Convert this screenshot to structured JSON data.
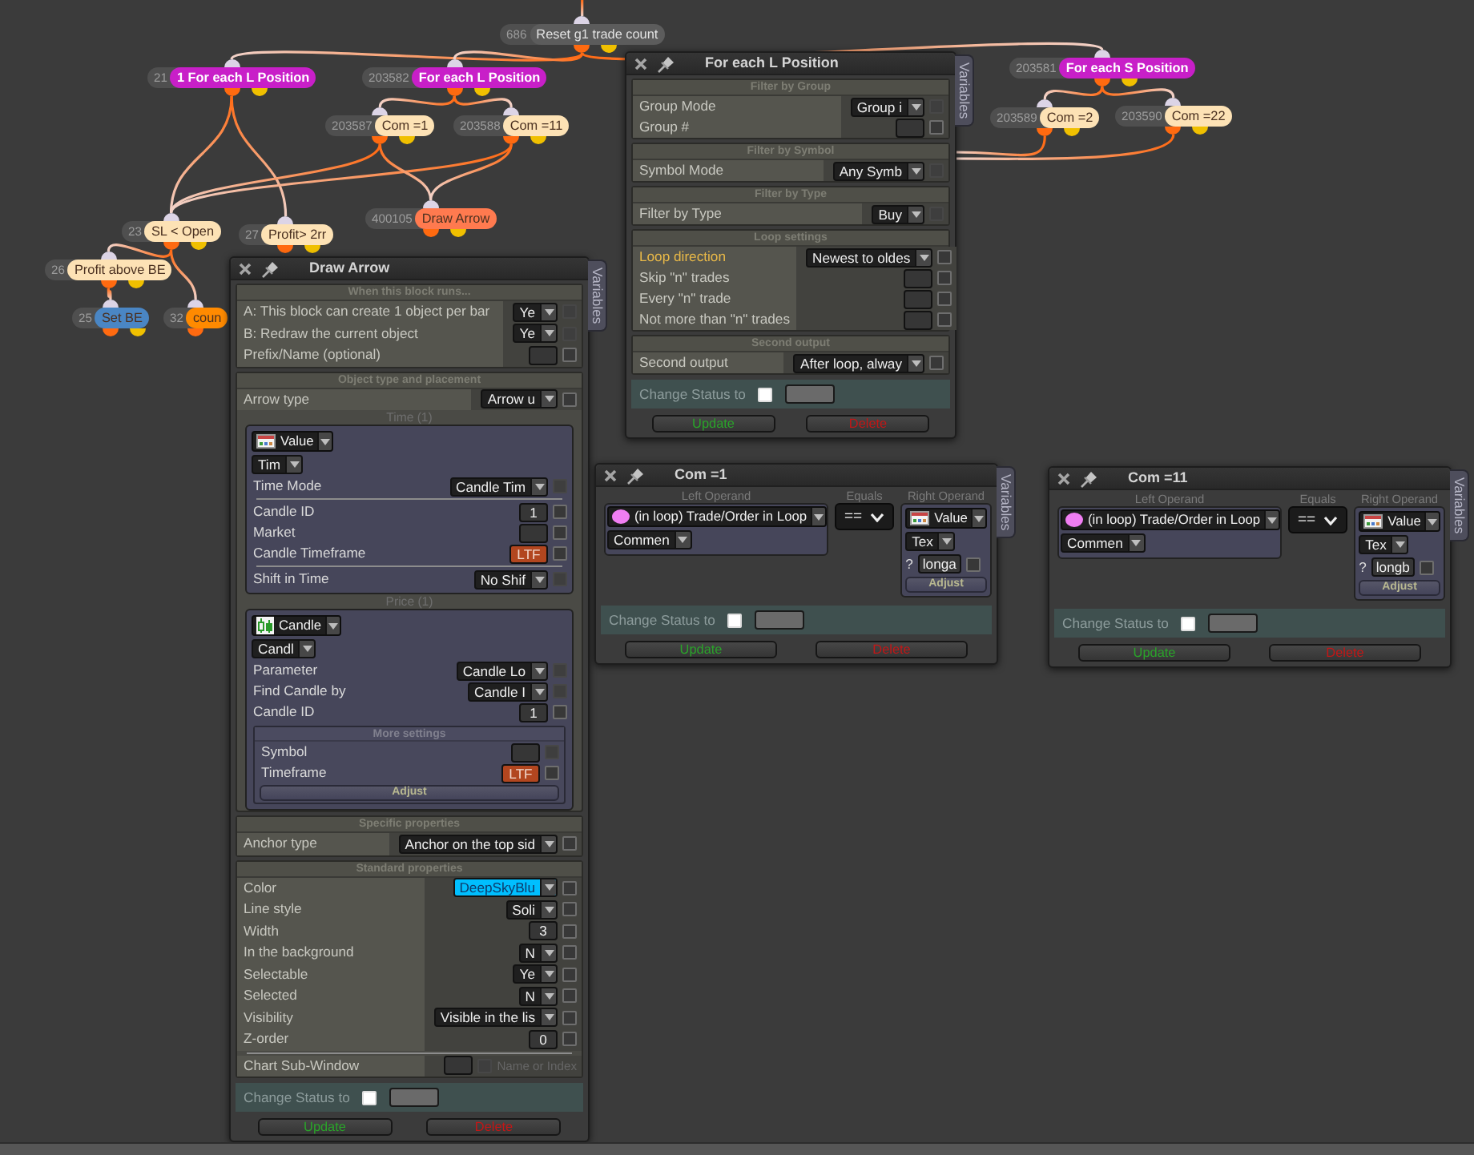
{
  "nodes": [
    {
      "number": "686",
      "label": "Reset g1 trade count",
      "color": "#5c5c5c"
    },
    {
      "number": "21",
      "label": "1 For each L Position",
      "color": "#c81fc8"
    },
    {
      "number": "203582",
      "label": "For each L Position",
      "color": "#c81fc8"
    },
    {
      "number": "203587",
      "label": "Com =1",
      "color": "#fde2b5"
    },
    {
      "number": "203588",
      "label": "Com =11",
      "color": "#fde2b5"
    },
    {
      "number": "400105",
      "label": "Draw Arrow",
      "color": "#ff7a4f"
    },
    {
      "number": "23",
      "label": "SL < Open",
      "color": "#fde2b5"
    },
    {
      "number": "27",
      "label": "Profit> 2rr",
      "color": "#fde2b5"
    },
    {
      "number": "26",
      "label": "Profit above BE",
      "color": "#fde2b5"
    },
    {
      "number": "25",
      "label": "Set BE",
      "color": "#4a86c4"
    },
    {
      "number": "32",
      "label": "coun",
      "color": "#ff8a00"
    },
    {
      "number": "203581",
      "label": "For each S Position",
      "color": "#c81fc8"
    },
    {
      "number": "203589",
      "label": "Com =2",
      "color": "#fde2b5"
    },
    {
      "number": "203590",
      "label": "Com =22",
      "color": "#fde2b5"
    }
  ],
  "panels": [
    {
      "kind": "block",
      "title": "For each L Position",
      "side_tab": "Variables",
      "sections": [
        {
          "title": "Filter by Group",
          "items": [
            {
              "kind": "row",
              "label": "Group Mode",
              "control": {
                "kind": "dropdown",
                "value": "Group i"
              },
              "checkbox": {
                "checked": false,
                "disabled": true
              }
            },
            {
              "kind": "row",
              "label": "Group #",
              "control": {
                "kind": "field"
              },
              "checkbox": {
                "checked": false,
                "disabled": false
              }
            }
          ]
        },
        {
          "title": "Filter by Symbol",
          "items": [
            {
              "kind": "row",
              "label": "Symbol Mode",
              "control": {
                "kind": "dropdown",
                "value": "Any Symb"
              },
              "checkbox": {
                "checked": false,
                "disabled": true
              }
            }
          ]
        },
        {
          "title": "Filter by Type",
          "items": [
            {
              "kind": "row",
              "label": "Filter by Type",
              "control": {
                "kind": "dropdown",
                "value": "Buy"
              },
              "checkbox": {
                "checked": false,
                "disabled": true
              }
            }
          ]
        },
        {
          "title": "Loop settings",
          "items": [
            {
              "kind": "row",
              "label": "Loop direction",
              "highlighted": true,
              "control": {
                "kind": "dropdown",
                "value": "Newest to oldes"
              },
              "checkbox": {
                "checked": false,
                "disabled": false
              }
            },
            {
              "kind": "row",
              "label": "Skip \"n\" trades",
              "highlighted": false,
              "control": {
                "kind": "field"
              },
              "checkbox": {
                "checked": false,
                "disabled": false
              }
            },
            {
              "kind": "row",
              "label": "Every \"n\" trade",
              "highlighted": false,
              "control": {
                "kind": "field"
              },
              "checkbox": {
                "checked": false,
                "disabled": false
              }
            },
            {
              "kind": "row",
              "label": "Not more than \"n\" trades",
              "highlighted": false,
              "control": {
                "kind": "field"
              },
              "checkbox": {
                "checked": false,
                "disabled": false
              }
            }
          ]
        },
        {
          "title": "Second output",
          "items": [
            {
              "kind": "row",
              "label": "Second output",
              "control": {
                "kind": "dropdown",
                "value": "After loop, alway"
              },
              "checkbox": {
                "checked": false,
                "disabled": false
              }
            }
          ]
        }
      ],
      "change_status": {
        "label": "Change Status to",
        "checked": false
      },
      "buttons": [
        {
          "label": "Update",
          "kind": "update"
        },
        {
          "label": "Delete",
          "kind": "delete"
        }
      ]
    },
    {
      "kind": "block",
      "title": "Draw Arrow",
      "side_tab": "Variables",
      "sections": [
        {
          "title": "When this block runs...",
          "items": [
            {
              "kind": "row",
              "label": "A: This block can create 1 object per bar",
              "control": {
                "kind": "dropdown",
                "value": "Ye"
              },
              "checkbox": {
                "checked": false,
                "disabled": true
              }
            },
            {
              "kind": "row",
              "label": "B: Redraw the current object",
              "control": {
                "kind": "dropdown",
                "value": "Ye"
              },
              "checkbox": {
                "checked": false,
                "disabled": true
              }
            },
            {
              "kind": "row",
              "label": "Prefix/Name (optional)",
              "control": {
                "kind": "field"
              },
              "checkbox": {
                "checked": false,
                "disabled": false
              }
            }
          ]
        },
        {
          "title": "Object type and placement",
          "items": [
            {
              "kind": "row",
              "label": "Arrow type",
              "control": {
                "kind": "dropdown",
                "value": "Arrow u"
              },
              "checkbox": {
                "checked": false,
                "disabled": false
              }
            },
            {
              "kind": "caption",
              "text": "Time (1)"
            },
            {
              "kind": "box",
              "items": [
                {
                  "kind": "value_picker",
                  "label": "Value"
                },
                {
                  "kind": "select",
                  "value": "Tim"
                },
                {
                  "kind": "row",
                  "label": "Time Mode",
                  "control": {
                    "kind": "dropdown",
                    "value": "Candle Tim"
                  },
                  "checkbox": {
                    "checked": false,
                    "disabled": true
                  }
                },
                {
                  "kind": "divider"
                },
                {
                  "kind": "row",
                  "label": "Candle ID",
                  "control": {
                    "kind": "field",
                    "value": "1"
                  },
                  "checkbox": {
                    "checked": false,
                    "disabled": false
                  }
                },
                {
                  "kind": "row",
                  "label": "Market",
                  "control": {
                    "kind": "field"
                  },
                  "checkbox": {
                    "checked": false,
                    "disabled": false
                  }
                },
                {
                  "kind": "row",
                  "label": "Candle Timeframe",
                  "control": {
                    "kind": "tag",
                    "value": "LTF"
                  },
                  "checkbox": {
                    "checked": false,
                    "disabled": false
                  }
                },
                {
                  "kind": "divider"
                },
                {
                  "kind": "row",
                  "label": "Shift in Time",
                  "control": {
                    "kind": "dropdown",
                    "value": "No Shif"
                  },
                  "checkbox": {
                    "checked": false,
                    "disabled": true
                  }
                }
              ]
            },
            {
              "kind": "caption",
              "text": "Price (1)"
            },
            {
              "kind": "box",
              "items": [
                {
                  "kind": "candle_picker",
                  "label": "Candle"
                },
                {
                  "kind": "select",
                  "value": "Candl"
                },
                {
                  "kind": "row",
                  "label": "Parameter",
                  "control": {
                    "kind": "dropdown",
                    "value": "Candle Lo"
                  },
                  "checkbox": {
                    "checked": false,
                    "disabled": true
                  }
                },
                {
                  "kind": "row",
                  "label": "Find Candle by",
                  "control": {
                    "kind": "dropdown",
                    "value": "Candle I"
                  },
                  "checkbox": {
                    "checked": false,
                    "disabled": true
                  }
                },
                {
                  "kind": "row",
                  "label": "Candle ID",
                  "control": {
                    "kind": "field",
                    "value": "1"
                  },
                  "checkbox": {
                    "checked": false,
                    "disabled": false
                  }
                },
                {
                  "kind": "section",
                  "title": "More settings",
                  "items": [
                    {
                      "kind": "row",
                      "label": "Symbol",
                      "control": {
                        "kind": "field"
                      },
                      "checkbox": {
                        "checked": false,
                        "disabled": true
                      }
                    },
                    {
                      "kind": "row",
                      "label": "Timeframe",
                      "control": {
                        "kind": "tag",
                        "value": "LTF"
                      },
                      "checkbox": {
                        "checked": false,
                        "disabled": false
                      }
                    },
                    {
                      "kind": "adjust",
                      "label": "Adjust"
                    }
                  ]
                }
              ]
            }
          ]
        },
        {
          "title": "Specific properties",
          "items": [
            {
              "kind": "row",
              "label": "Anchor type",
              "control": {
                "kind": "dropdown",
                "value": "Anchor on the top sid"
              },
              "checkbox": {
                "checked": false,
                "disabled": false
              }
            }
          ]
        },
        {
          "title": "Standard properties",
          "items": [
            {
              "kind": "row",
              "label": "Color",
              "control": {
                "kind": "color",
                "value": "DeepSkyBlu",
                "color": "#00bfff"
              },
              "checkbox": {
                "checked": false,
                "disabled": false
              }
            },
            {
              "kind": "row",
              "label": "Line style",
              "control": {
                "kind": "dropdown",
                "value": "Soli"
              },
              "checkbox": {
                "checked": false,
                "disabled": false
              }
            },
            {
              "kind": "row",
              "label": "Width",
              "control": {
                "kind": "field",
                "value": "3"
              },
              "checkbox": {
                "checked": false,
                "disabled": false
              }
            },
            {
              "kind": "row",
              "label": "In the background",
              "control": {
                "kind": "dropdown",
                "value": "N"
              },
              "checkbox": {
                "checked": false,
                "disabled": false
              }
            },
            {
              "kind": "row",
              "label": "Selectable",
              "control": {
                "kind": "dropdown",
                "value": "Ye"
              },
              "checkbox": {
                "checked": false,
                "disabled": false
              }
            },
            {
              "kind": "row",
              "label": "Selected",
              "control": {
                "kind": "dropdown",
                "value": "N"
              },
              "checkbox": {
                "checked": false,
                "disabled": false
              }
            },
            {
              "kind": "row",
              "label": "Visibility",
              "control": {
                "kind": "dropdown",
                "value": "Visible in the lis"
              },
              "checkbox": {
                "checked": false,
                "disabled": false
              }
            },
            {
              "kind": "row",
              "label": "Z-order",
              "control": {
                "kind": "field",
                "value": "0"
              },
              "checkbox": {
                "checked": false,
                "disabled": false
              }
            },
            {
              "kind": "divider"
            },
            {
              "kind": "row",
              "label": "Chart Sub-Window",
              "control": {
                "kind": "field"
              },
              "checkbox": {
                "checked": false,
                "disabled": true
              },
              "hint": "Name or Index"
            }
          ]
        }
      ],
      "change_status": {
        "label": "Change Status to",
        "checked": false
      },
      "buttons": [
        {
          "label": "Update",
          "kind": "update"
        },
        {
          "label": "Delete",
          "kind": "delete"
        }
      ]
    },
    {
      "kind": "compare",
      "title": "Com =1",
      "side_tab": "Variables",
      "left": {
        "caption": "Left Operand",
        "picker": {
          "kind": "loop_picker",
          "label": "(in loop) Trade/Order in Loop"
        },
        "select": "Commen"
      },
      "operator": {
        "caption": "Equals",
        "value": "=="
      },
      "right": {
        "caption": "Right Operand",
        "picker": {
          "kind": "value_picker",
          "label": "Value"
        },
        "select": "Tex",
        "prompt": "?",
        "field": {
          "value": "longa"
        },
        "checkbox": {
          "checked": false
        },
        "adjust": "Adjust"
      },
      "change_status": {
        "label": "Change Status to",
        "checked": false
      },
      "buttons": [
        {
          "label": "Update",
          "kind": "update"
        },
        {
          "label": "Delete",
          "kind": "delete"
        }
      ]
    },
    {
      "kind": "compare",
      "title": "Com =11",
      "side_tab": "Variables",
      "left": {
        "caption": "Left Operand",
        "picker": {
          "kind": "loop_picker",
          "label": "(in loop) Trade/Order in Loop"
        },
        "select": "Commen"
      },
      "operator": {
        "caption": "Equals",
        "value": "=="
      },
      "right": {
        "caption": "Right Operand",
        "picker": {
          "kind": "value_picker",
          "label": "Value"
        },
        "select": "Tex",
        "prompt": "?",
        "field": {
          "value": "longb"
        },
        "checkbox": {
          "checked": false
        },
        "adjust": "Adjust"
      },
      "change_status": {
        "label": "Change Status to",
        "checked": false
      },
      "buttons": [
        {
          "label": "Update",
          "kind": "update"
        },
        {
          "label": "Delete",
          "kind": "delete"
        }
      ]
    }
  ]
}
